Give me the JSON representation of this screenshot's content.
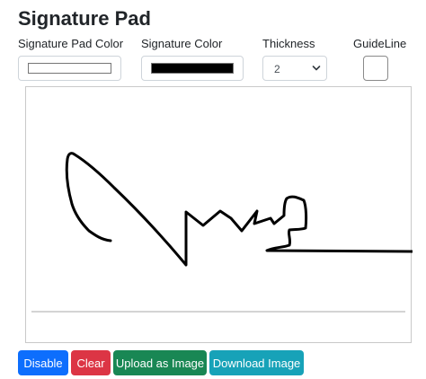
{
  "page": {
    "title": "Signature Pad"
  },
  "controls": {
    "pad_color_label": "Signature Pad Color",
    "pad_color_value": "#ffffff",
    "sig_color_label": "Signature Color",
    "sig_color_value": "#000000",
    "thickness_label": "Thickness",
    "thickness_value": "2",
    "guideline_label": "GuideLine",
    "guideline_checked": false
  },
  "buttons": {
    "disable": "Disable",
    "clear": "Clear",
    "upload": "Upload as Image",
    "download": "Download Image"
  },
  "colors": {
    "primary": "#0d6efd",
    "danger": "#dc3545",
    "success": "#198754",
    "info": "#17a2b8"
  }
}
